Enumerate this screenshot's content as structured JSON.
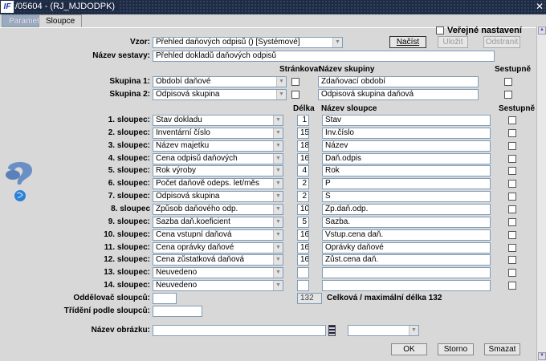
{
  "window": {
    "title": "/05604 - (RJ_MJDODPK)",
    "logo": "IF",
    "close": "✕"
  },
  "tabs": [
    {
      "label": "Parametry"
    },
    {
      "label": "Sloupce"
    }
  ],
  "top": {
    "public_label": "Veřejné nastavení",
    "public_checked": false,
    "vzor_label": "Vzor:",
    "vzor_value": "Přehled daňových odpisů   ()   [Systémové]",
    "load": "Načíst",
    "save": "Uložit",
    "remove": "Odstranit",
    "name_label": "Název sestavy:",
    "name_value": "Přehled dokladů daňových odpisů"
  },
  "groups": {
    "h_page": "Stránkovat",
    "h_name": "Název skupiny",
    "h_desc": "Sestupně",
    "rows": [
      {
        "label": "Skupina 1:",
        "value": "Období daňové",
        "name": "Zdaňovací období"
      },
      {
        "label": "Skupina 2:",
        "value": "Odpisová skupina",
        "name": "Odpisová skupina daňová"
      }
    ]
  },
  "columns": {
    "h_len": "Délka",
    "h_name": "Název sloupce",
    "h_desc": "Sestupně",
    "rows": [
      {
        "label": "1. sloupec:",
        "value": "Stav dokladu",
        "len": "1",
        "name": "Stav"
      },
      {
        "label": "2. sloupec:",
        "value": "Inventární číslo",
        "len": "15",
        "name": "Inv.číslo"
      },
      {
        "label": "3. sloupec:",
        "value": "Název majetku",
        "len": "18",
        "name": "Název"
      },
      {
        "label": "4. sloupec:",
        "value": "Cena odpisů daňových",
        "len": "16",
        "name": "Daň.odpis"
      },
      {
        "label": "5. sloupec:",
        "value": "Rok výroby",
        "len": "4",
        "name": "Rok"
      },
      {
        "label": "6. sloupec:",
        "value": "Počet daňově odeps. let/měs",
        "len": "2",
        "name": "P"
      },
      {
        "label": "7. sloupec:",
        "value": "Odpisová skupina",
        "len": "2",
        "name": "S"
      },
      {
        "label": "8. sloupec",
        "value": "Způsob daňového odp.",
        "len": "10",
        "name": "Zp.daň.odp."
      },
      {
        "label": "9. sloupec:",
        "value": "Sazba daň.koeficient",
        "len": "5",
        "name": "Sazba."
      },
      {
        "label": "10. sloupec:",
        "value": "Cena vstupní daňová",
        "len": "16",
        "name": "Vstup.cena daň."
      },
      {
        "label": "11. sloupec:",
        "value": "Cena oprávky daňové",
        "len": "16",
        "name": "Oprávky daňové"
      },
      {
        "label": "12. sloupec:",
        "value": "Cena zůstatková daňová",
        "len": "16",
        "name": "Zůst.cena daň."
      },
      {
        "label": "13. sloupec:",
        "value": "Neuvedeno",
        "len": "",
        "name": ""
      },
      {
        "label": "14. sloupec:",
        "value": "Neuvedeno",
        "len": "",
        "name": ""
      }
    ]
  },
  "bottom": {
    "sep_label": "Oddělovač sloupců:",
    "sep_value": "",
    "total": "132",
    "total_label": "Celková / maximální délka 132",
    "sort_label": "Třídění podle sloupců:",
    "sort_value": "",
    "img_label": "Název obrázku:",
    "img_value": "",
    "img_select": ""
  },
  "buttons": {
    "ok": "OK",
    "cancel": "Storno",
    "delete": "Smazat"
  },
  "icons": {
    "help": "question-globe-icon"
  }
}
